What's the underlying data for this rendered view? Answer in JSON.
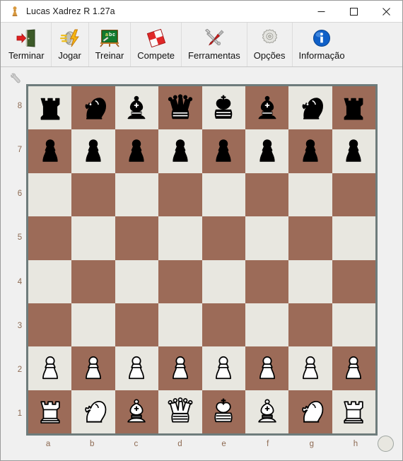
{
  "window": {
    "title": "Lucas Xadrez R 1.27a",
    "icon": "chess-pawn-icon",
    "controls": {
      "minimize": "minimize-icon",
      "maximize": "maximize-icon",
      "close": "close-icon"
    }
  },
  "toolbar": {
    "items": [
      {
        "label": "Terminar",
        "icon": "exit-door-icon"
      },
      {
        "label": "Jogar",
        "icon": "lightning-play-icon"
      },
      {
        "label": "Treinar",
        "icon": "chalkboard-abc-icon"
      },
      {
        "label": "Compete",
        "icon": "checkered-diamond-icon"
      },
      {
        "label": "Ferramentas",
        "icon": "wrench-screwdriver-icon"
      },
      {
        "label": "Opções",
        "icon": "gear-icon"
      },
      {
        "label": "Informação",
        "icon": "info-circle-icon"
      }
    ]
  },
  "board": {
    "corner_icon": "wrench-icon",
    "resize_grip": "resize-grip-circle",
    "colors": {
      "light_square": "#E8E7E0",
      "dark_square": "#9C6B58",
      "border": "#6E7C7C",
      "coordinate_label": "#8D6A52"
    },
    "rank_labels": [
      "8",
      "7",
      "6",
      "5",
      "4",
      "3",
      "2",
      "1"
    ],
    "file_labels": [
      "a",
      "b",
      "c",
      "d",
      "e",
      "f",
      "g",
      "h"
    ],
    "position_fen": "rnbqkbnr/pppppppp/8/8/8/8/PPPPPPPP/RNBQKBNR",
    "ranks": [
      [
        "br",
        "bn",
        "bb",
        "bq",
        "bk",
        "bb",
        "bn",
        "br"
      ],
      [
        "bp",
        "bp",
        "bp",
        "bp",
        "bp",
        "bp",
        "bp",
        "bp"
      ],
      [
        "",
        "",
        "",
        "",
        "",
        "",
        "",
        ""
      ],
      [
        "",
        "",
        "",
        "",
        "",
        "",
        "",
        ""
      ],
      [
        "",
        "",
        "",
        "",
        "",
        "",
        "",
        ""
      ],
      [
        "",
        "",
        "",
        "",
        "",
        "",
        "",
        ""
      ],
      [
        "wp",
        "wp",
        "wp",
        "wp",
        "wp",
        "wp",
        "wp",
        "wp"
      ],
      [
        "wr",
        "wn",
        "wb",
        "wq",
        "wk",
        "wb",
        "wn",
        "wr"
      ]
    ]
  }
}
